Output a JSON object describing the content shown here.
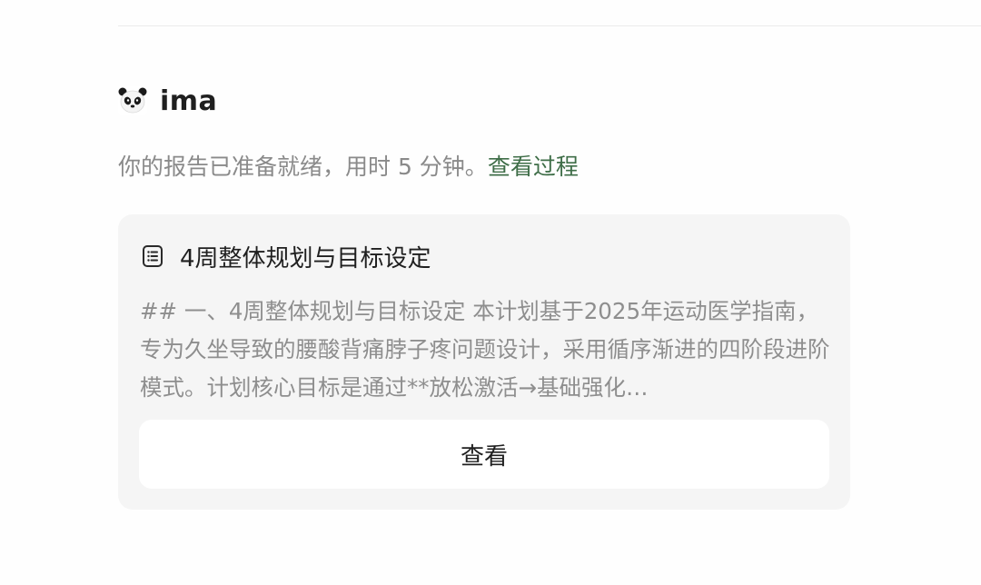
{
  "bot": {
    "name": "ima",
    "avatar_icon": "panda-avatar-icon"
  },
  "status": {
    "message": "你的报告已准备就绪，用时 5 分钟。",
    "link_label": "查看过程",
    "link_color": "#3f6e48"
  },
  "report_card": {
    "icon": "document-list-icon",
    "title": "4周整体规划与目标设定",
    "excerpt": "## 一、4周整体规划与目标设定 本计划基于2025年运动医学指南，专为久坐导致的腰酸背痛脖子疼问题设计，采用循序渐进的四阶段进阶模式。计划核心目标是通过**放松激活→基础强化…",
    "button_label": "查看"
  }
}
